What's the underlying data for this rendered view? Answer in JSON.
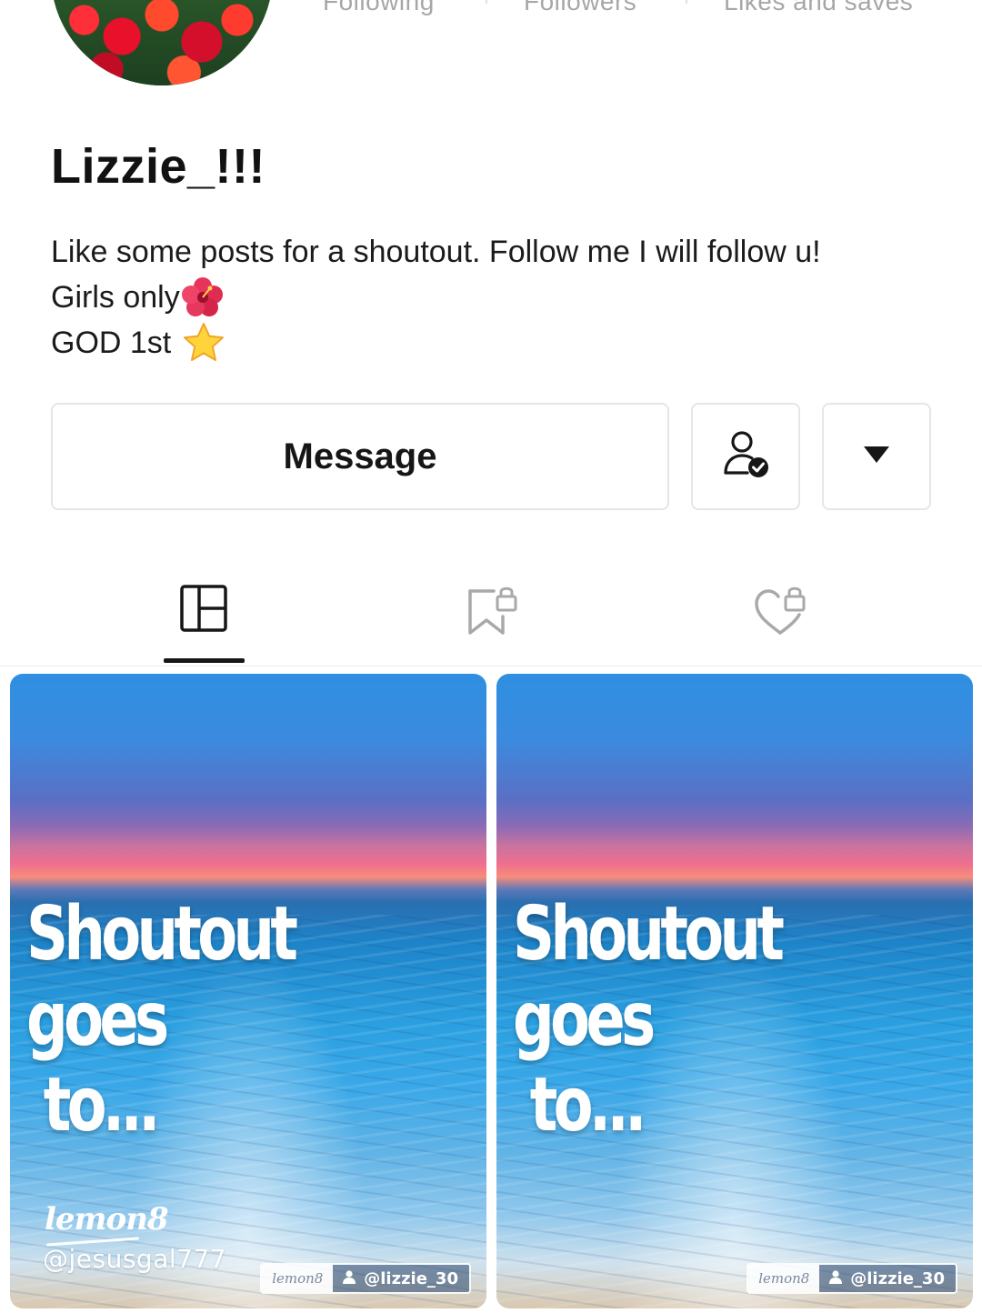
{
  "profile": {
    "stats": {
      "following_label": "Following",
      "followers_label": "Followers",
      "likes_label": "Likes and saves"
    },
    "username": "Lizzie_!!!",
    "bio": {
      "line1": "Like some posts for a shoutout. Follow me I will follow u!",
      "line2": "Girls only",
      "line3": "GOD 1st"
    }
  },
  "actions": {
    "message_label": "Message"
  },
  "posts": [
    {
      "title_line1": "Shoutout goes",
      "title_line2": "to...",
      "brand": "lemon8",
      "handle": "@jesusgal777",
      "watermark_logo": "lemon8",
      "watermark_user": "@lizzie_30"
    },
    {
      "title_line1": "Shoutout goes",
      "title_line2": "to...",
      "watermark_logo": "lemon8",
      "watermark_user": "@lizzie_30"
    }
  ]
}
